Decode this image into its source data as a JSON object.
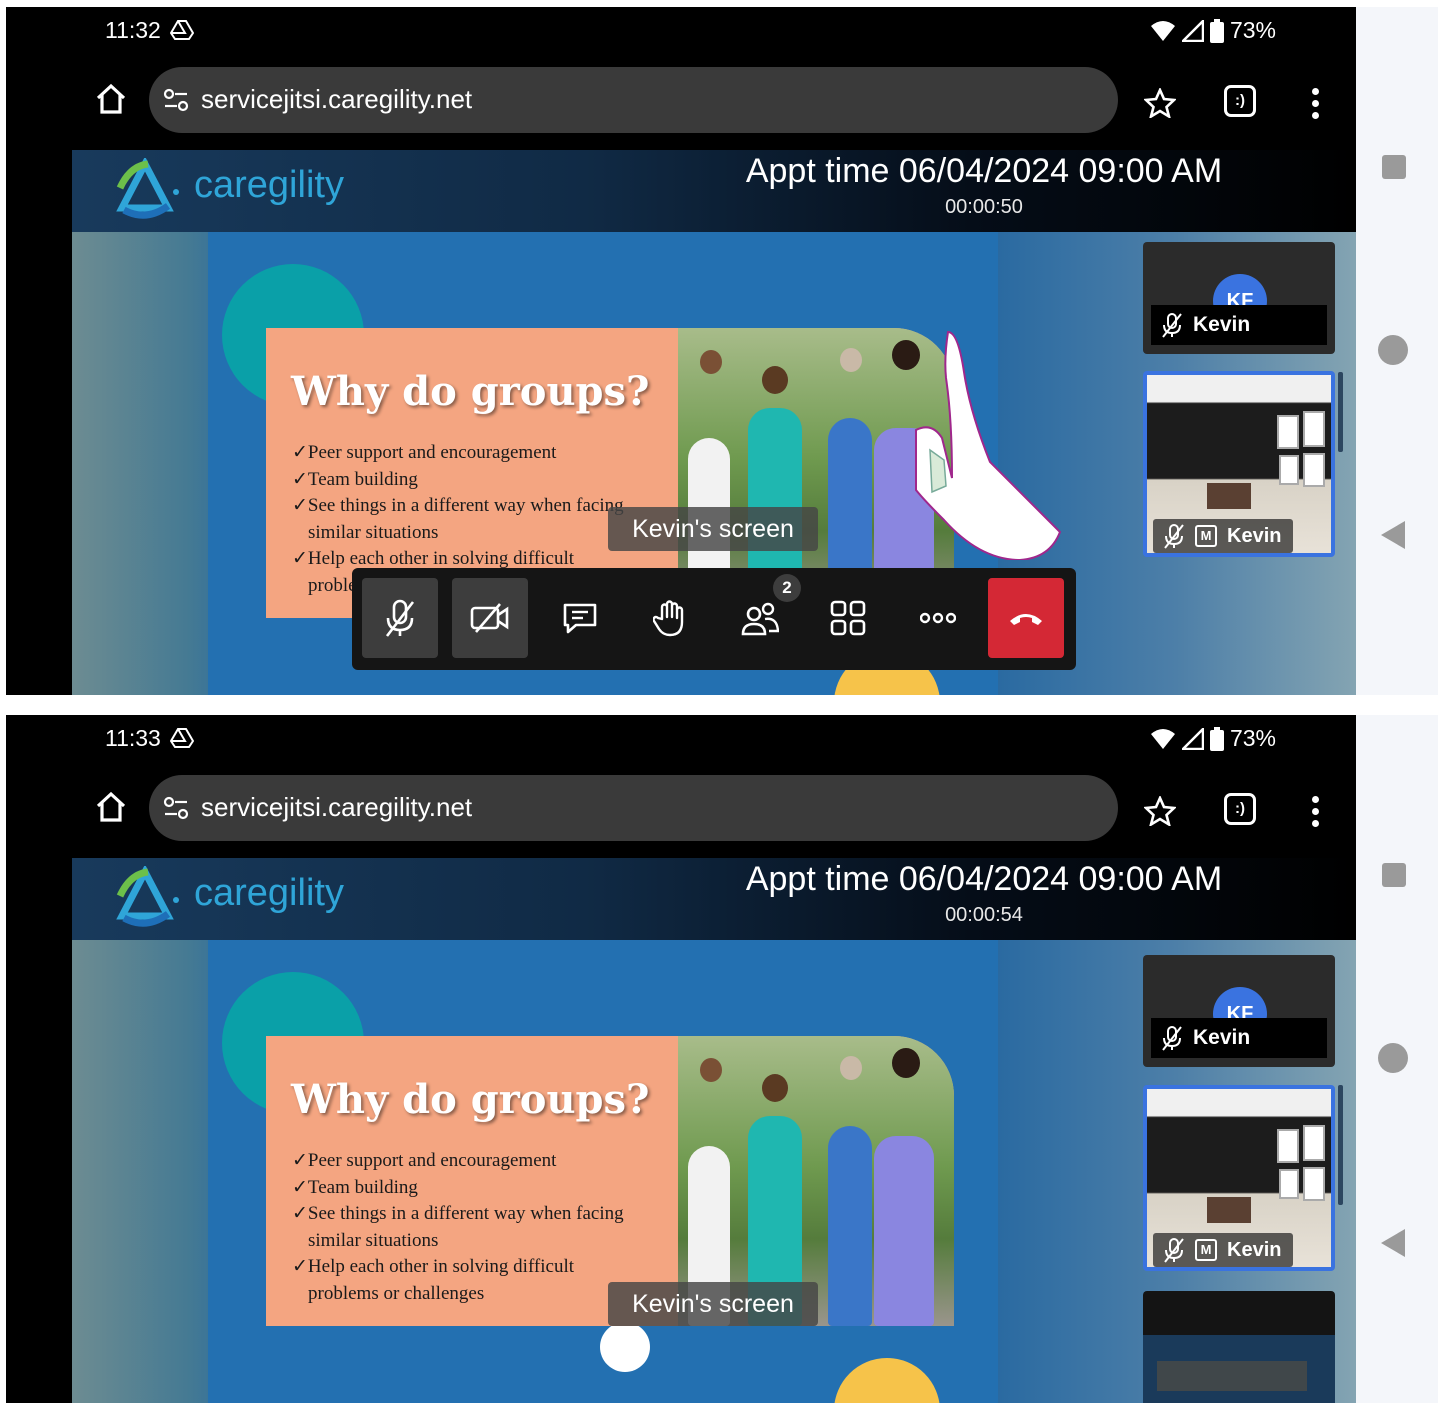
{
  "frames": [
    {
      "status": {
        "time": "11:32",
        "battery": "73%"
      },
      "browser": {
        "url": "servicejitsi.caregility.net",
        "tab_icon": ":)"
      },
      "header": {
        "brand": "caregility",
        "appt": "Appt time 06/04/2024 09:00 AM",
        "timer": "00:00:50"
      },
      "slide": {
        "title": "Why do groups?",
        "bullets": [
          "✓Peer support and encouragement",
          "✓Team building",
          "✓See things in a different way when facing",
          "similar situations",
          "✓Help each other in solving difficult",
          "problems or challenges"
        ]
      },
      "screen_label": "Kevin's screen",
      "toolbar_visible": true,
      "participants_badge": "2",
      "tiles": [
        {
          "initials": "KF",
          "name": "Kevin"
        },
        {
          "moderator_icon": "M",
          "name": "Kevin"
        }
      ]
    },
    {
      "status": {
        "time": "11:33",
        "battery": "73%"
      },
      "browser": {
        "url": "servicejitsi.caregility.net",
        "tab_icon": ":)"
      },
      "header": {
        "brand": "caregility",
        "appt": "Appt time 06/04/2024 09:00 AM",
        "timer": "00:00:54"
      },
      "slide": {
        "title": "Why do groups?",
        "bullets": [
          "✓Peer support and encouragement",
          "✓Team building",
          "✓See things in a different way when facing",
          "similar situations",
          "✓Help each other in solving difficult",
          "problems or challenges"
        ]
      },
      "screen_label": "Kevin's screen",
      "toolbar_visible": false,
      "tiles": [
        {
          "initials": "KF",
          "name": "Kevin"
        },
        {
          "moderator_icon": "M",
          "name": "Kevin"
        }
      ]
    }
  ],
  "icons": [
    "drive-icon",
    "wifi-icon",
    "signal-icon",
    "battery-icon",
    "home-icon",
    "site-settings-icon",
    "star-icon",
    "tabs-icon",
    "more-vert-icon",
    "mic-muted-icon",
    "camera-off-icon",
    "chat-icon",
    "raise-hand-icon",
    "participants-icon",
    "tile-view-icon",
    "more-horiz-icon",
    "hangup-icon",
    "nav-recents-icon",
    "nav-home-icon",
    "nav-back-icon"
  ],
  "colors": {
    "accent": "#3a73e0",
    "hangup": "#d42835",
    "slide_bg": "#2370b1",
    "card": "#f4a581",
    "brand": "#2fa5d8"
  }
}
